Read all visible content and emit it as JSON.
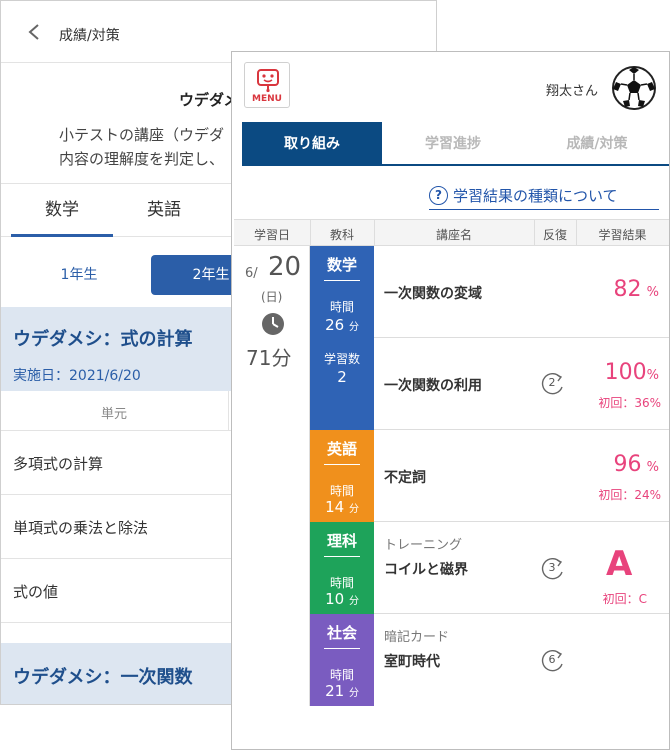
{
  "back_screen": {
    "title": "成績/対策",
    "heading": "ウデダメ",
    "description_lines": [
      "小テストの講座（ウデダ",
      "内容の理解度を判定し、"
    ],
    "subject_tabs": [
      "数学",
      "英語"
    ],
    "grade_buttons": [
      "1年生",
      "2年生"
    ],
    "test1": {
      "name": "ウデダメシ：式の計算",
      "date": "実施日：2021/6/20"
    },
    "unit_header": "単元",
    "units": [
      "多項式の計算",
      "単項式の乗法と除法",
      "式の値"
    ],
    "test2": {
      "name": "ウデダメシ：一次関数"
    }
  },
  "front_screen": {
    "menu_label": "MENU",
    "user_name": "翔太さん",
    "tabs": [
      "取り組み",
      "学習進捗",
      "成績/対策"
    ],
    "help_link": "学習結果の種類について",
    "help_icon_glyph": "?",
    "table_headers": [
      "学習日",
      "教科",
      "講座名",
      "反復",
      "学習結果"
    ],
    "date": {
      "month": "6/",
      "day": "20",
      "dow": "(日)",
      "total": "71分"
    },
    "subjects": [
      {
        "name": "数学",
        "time_label": "時間",
        "time_value": "26",
        "time_unit": "分",
        "count_label": "学習数",
        "count_value": "2",
        "color": "#2f63b5"
      },
      {
        "name": "英語",
        "time_label": "時間",
        "time_value": "14",
        "time_unit": "分",
        "color": "#f0901c"
      },
      {
        "name": "理科",
        "time_label": "時間",
        "time_value": "10",
        "time_unit": "分",
        "color": "#1ea35a"
      },
      {
        "name": "社会",
        "time_label": "時間",
        "time_value": "21",
        "time_unit": "分",
        "color": "#7a5cc0"
      }
    ],
    "rows": [
      {
        "course": "一次関数の変域",
        "result": "82",
        "result_unit": "%"
      },
      {
        "course": "一次関数の利用",
        "repeat": "2",
        "result": "100",
        "result_unit": "%",
        "first": "初回：36%"
      },
      {
        "course": "不定詞",
        "result": "96",
        "result_unit": "%",
        "first": "初回：24%"
      },
      {
        "category": "トレーニング",
        "course": "コイルと磁界",
        "repeat": "3",
        "result": "A",
        "first": "初回：C"
      },
      {
        "category": "暗記カード",
        "course": "室町時代",
        "repeat": "6"
      }
    ],
    "colors": {
      "accent_navy": "#0b4a82",
      "link_blue": "#2255aa",
      "result_pink": "#e8437c"
    }
  }
}
